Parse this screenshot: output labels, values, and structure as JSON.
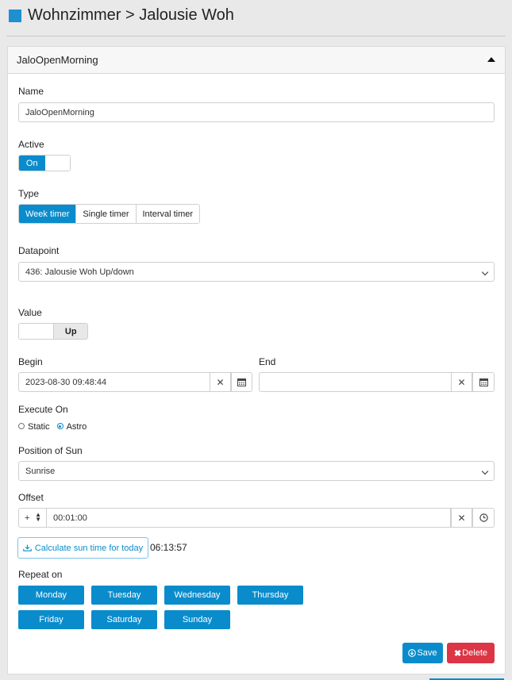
{
  "header": {
    "title": "Wohnzimmer > Jalousie Woh"
  },
  "card": {
    "title": "JaloOpenMorning"
  },
  "name": {
    "label": "Name",
    "value": "JaloOpenMorning"
  },
  "active": {
    "label": "Active",
    "on_label": "On"
  },
  "type": {
    "label": "Type",
    "options": [
      "Week timer",
      "Single timer",
      "Interval timer"
    ],
    "selected": "Week timer"
  },
  "datapoint": {
    "label": "Datapoint",
    "value": "436: Jalousie Woh Up/down"
  },
  "value": {
    "label": "Value",
    "current": "Up"
  },
  "begin": {
    "label": "Begin",
    "value": "2023-08-30 09:48:44"
  },
  "end": {
    "label": "End",
    "value": ""
  },
  "execute_on": {
    "label": "Execute On",
    "options": [
      "Static",
      "Astro"
    ],
    "selected": "Astro"
  },
  "sun_position": {
    "label": "Position of Sun",
    "value": "Sunrise"
  },
  "offset": {
    "label": "Offset",
    "sign": "+",
    "value": "00:01:00"
  },
  "calc": {
    "button_label": "Calculate sun time for today",
    "result": "06:13:57"
  },
  "repeat": {
    "label": "Repeat on",
    "days": [
      "Monday",
      "Tuesday",
      "Wednesday",
      "Thursday",
      "Friday",
      "Saturday",
      "Sunday"
    ]
  },
  "actions": {
    "save_label": "Save",
    "delete_label": "Delete"
  },
  "colors": {
    "accent": "#0a8ccc",
    "header_square": "#1e8fd1",
    "delete": "#dc3545",
    "background": "#e9e9ea"
  },
  "icons": [
    "collapse-up-icon",
    "clear-icon",
    "calendar-icon",
    "clock-icon",
    "download-icon",
    "save-icon",
    "delete-icon",
    "sort-icon",
    "chevron-down-icon"
  ]
}
